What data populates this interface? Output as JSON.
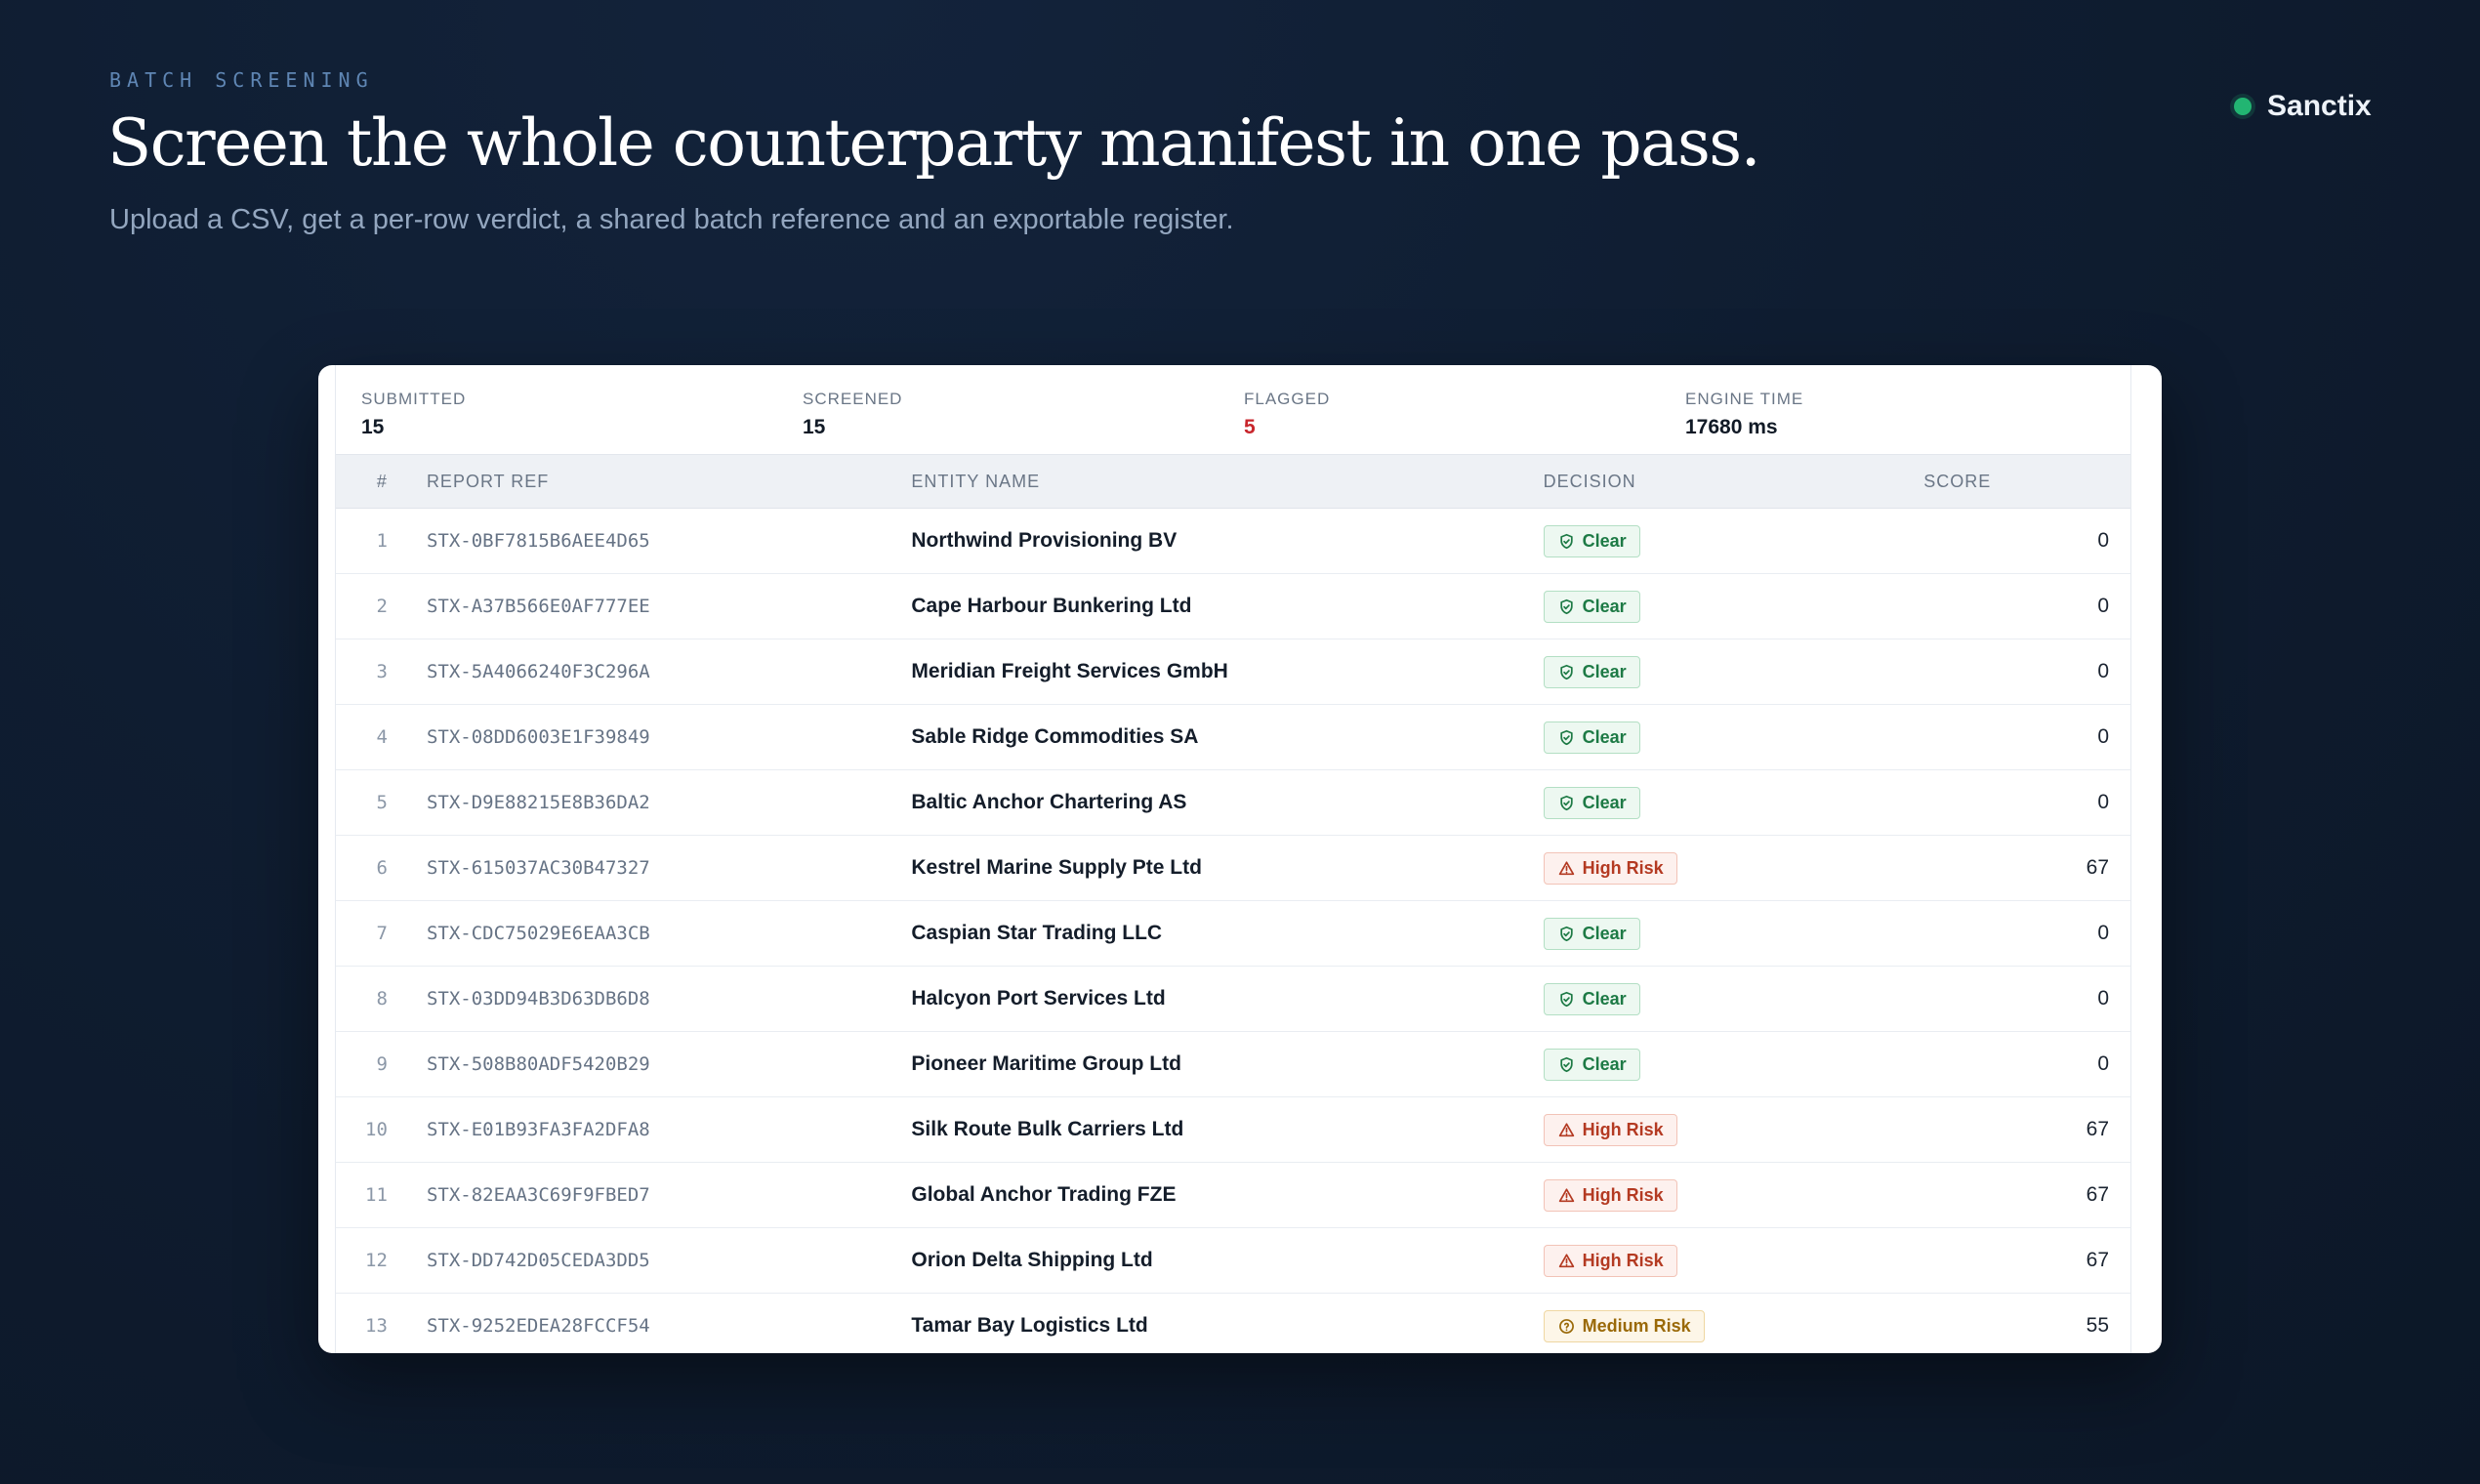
{
  "header": {
    "eyebrow": "BATCH SCREENING",
    "title": "Screen the whole counterparty manifest in one pass.",
    "subtitle": "Upload a CSV, get a per-row verdict, a shared batch reference and an exportable register.",
    "brand": "Sanctix"
  },
  "stats": {
    "submitted_label": "SUBMITTED",
    "submitted": "15",
    "screened_label": "SCREENED",
    "screened": "15",
    "flagged_label": "FLAGGED",
    "flagged": "5",
    "engine_label": "ENGINE TIME",
    "engine": "17680 ms"
  },
  "table": {
    "columns": {
      "num": "#",
      "ref": "REPORT REF",
      "entity": "ENTITY NAME",
      "decision": "DECISION",
      "score": "SCORE"
    },
    "rows": [
      {
        "num": "1",
        "ref": "STX-0BF7815B6AEE4D65",
        "entity": "Northwind Provisioning BV",
        "decision": "Clear",
        "level": "clear",
        "score": "0"
      },
      {
        "num": "2",
        "ref": "STX-A37B566E0AF777EE",
        "entity": "Cape Harbour Bunkering Ltd",
        "decision": "Clear",
        "level": "clear",
        "score": "0"
      },
      {
        "num": "3",
        "ref": "STX-5A4066240F3C296A",
        "entity": "Meridian Freight Services GmbH",
        "decision": "Clear",
        "level": "clear",
        "score": "0"
      },
      {
        "num": "4",
        "ref": "STX-08DD6003E1F39849",
        "entity": "Sable Ridge Commodities SA",
        "decision": "Clear",
        "level": "clear",
        "score": "0"
      },
      {
        "num": "5",
        "ref": "STX-D9E88215E8B36DA2",
        "entity": "Baltic Anchor Chartering AS",
        "decision": "Clear",
        "level": "clear",
        "score": "0"
      },
      {
        "num": "6",
        "ref": "STX-615037AC30B47327",
        "entity": "Kestrel Marine Supply Pte Ltd",
        "decision": "High Risk",
        "level": "high",
        "score": "67"
      },
      {
        "num": "7",
        "ref": "STX-CDC75029E6EAA3CB",
        "entity": "Caspian Star Trading LLC",
        "decision": "Clear",
        "level": "clear",
        "score": "0"
      },
      {
        "num": "8",
        "ref": "STX-03DD94B3D63DB6D8",
        "entity": "Halcyon Port Services Ltd",
        "decision": "Clear",
        "level": "clear",
        "score": "0"
      },
      {
        "num": "9",
        "ref": "STX-508B80ADF5420B29",
        "entity": "Pioneer Maritime Group Ltd",
        "decision": "Clear",
        "level": "clear",
        "score": "0"
      },
      {
        "num": "10",
        "ref": "STX-E01B93FA3FA2DFA8",
        "entity": "Silk Route Bulk Carriers Ltd",
        "decision": "High Risk",
        "level": "high",
        "score": "67"
      },
      {
        "num": "11",
        "ref": "STX-82EAA3C69F9FBED7",
        "entity": "Global Anchor Trading FZE",
        "decision": "High Risk",
        "level": "high",
        "score": "67"
      },
      {
        "num": "12",
        "ref": "STX-DD742D05CEDA3DD5",
        "entity": "Orion Delta Shipping Ltd",
        "decision": "High Risk",
        "level": "high",
        "score": "67"
      },
      {
        "num": "13",
        "ref": "STX-9252EDEA28FCCF54",
        "entity": "Tamar Bay Logistics Ltd",
        "decision": "Medium Risk",
        "level": "med",
        "score": "55"
      }
    ]
  },
  "icons": {
    "clear": "shield-check-icon",
    "high": "warning-triangle-icon",
    "med": "help-circle-icon"
  },
  "colors": {
    "clear": "#1d7a45",
    "high": "#b43a22",
    "med": "#9a6908",
    "flagged": "#c8262c",
    "brand_dot": "#22b572"
  }
}
